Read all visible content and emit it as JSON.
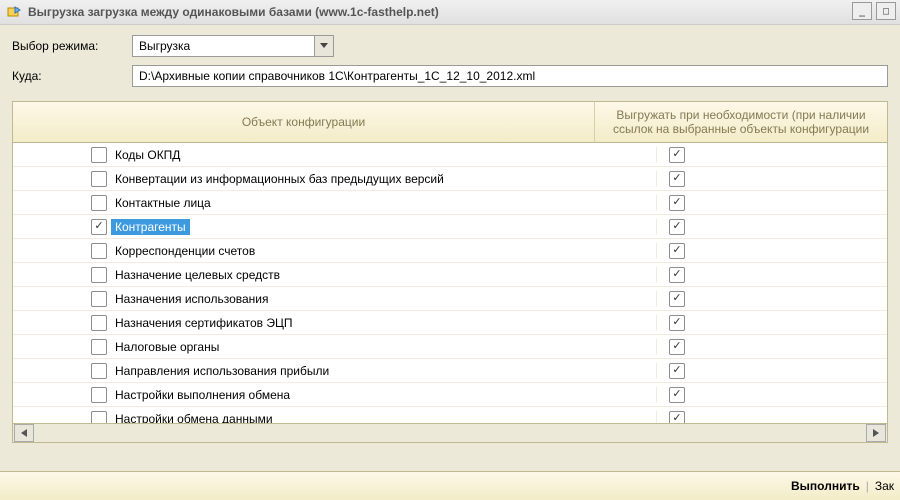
{
  "window": {
    "title": "Выгрузка загрузка между одинаковыми базами (www.1c-fasthelp.net)"
  },
  "form": {
    "mode_label": "Выбор режима:",
    "mode_value": "Выгрузка",
    "path_label": "Куда:",
    "path_value": "D:\\Архивные копии справочников 1С\\Контрагенты_1С_12_10_2012.xml"
  },
  "grid": {
    "col1": "Объект конфигурации",
    "col2": "Выгружать при необходимости (при наличии ссылок на выбранные объекты конфигурации",
    "rows": [
      {
        "label": "Коды ОКПД",
        "left": false,
        "right": true,
        "selected": false
      },
      {
        "label": "Конвертации из информационных баз предыдущих версий",
        "left": false,
        "right": true,
        "selected": false
      },
      {
        "label": "Контактные лица",
        "left": false,
        "right": true,
        "selected": false
      },
      {
        "label": "Контрагенты",
        "left": true,
        "right": true,
        "selected": true
      },
      {
        "label": "Корреспонденции счетов",
        "left": false,
        "right": true,
        "selected": false
      },
      {
        "label": "Назначение целевых средств",
        "left": false,
        "right": true,
        "selected": false
      },
      {
        "label": "Назначения использования",
        "left": false,
        "right": true,
        "selected": false
      },
      {
        "label": "Назначения сертификатов ЭЦП",
        "left": false,
        "right": true,
        "selected": false
      },
      {
        "label": "Налоговые органы",
        "left": false,
        "right": true,
        "selected": false
      },
      {
        "label": "Направления использования прибыли",
        "left": false,
        "right": true,
        "selected": false
      },
      {
        "label": "Настройки выполнения обмена",
        "left": false,
        "right": true,
        "selected": false
      },
      {
        "label": "Настройки обмена данными",
        "left": false,
        "right": true,
        "selected": false
      }
    ]
  },
  "footer": {
    "execute": "Выполнить",
    "close": "Зак"
  }
}
